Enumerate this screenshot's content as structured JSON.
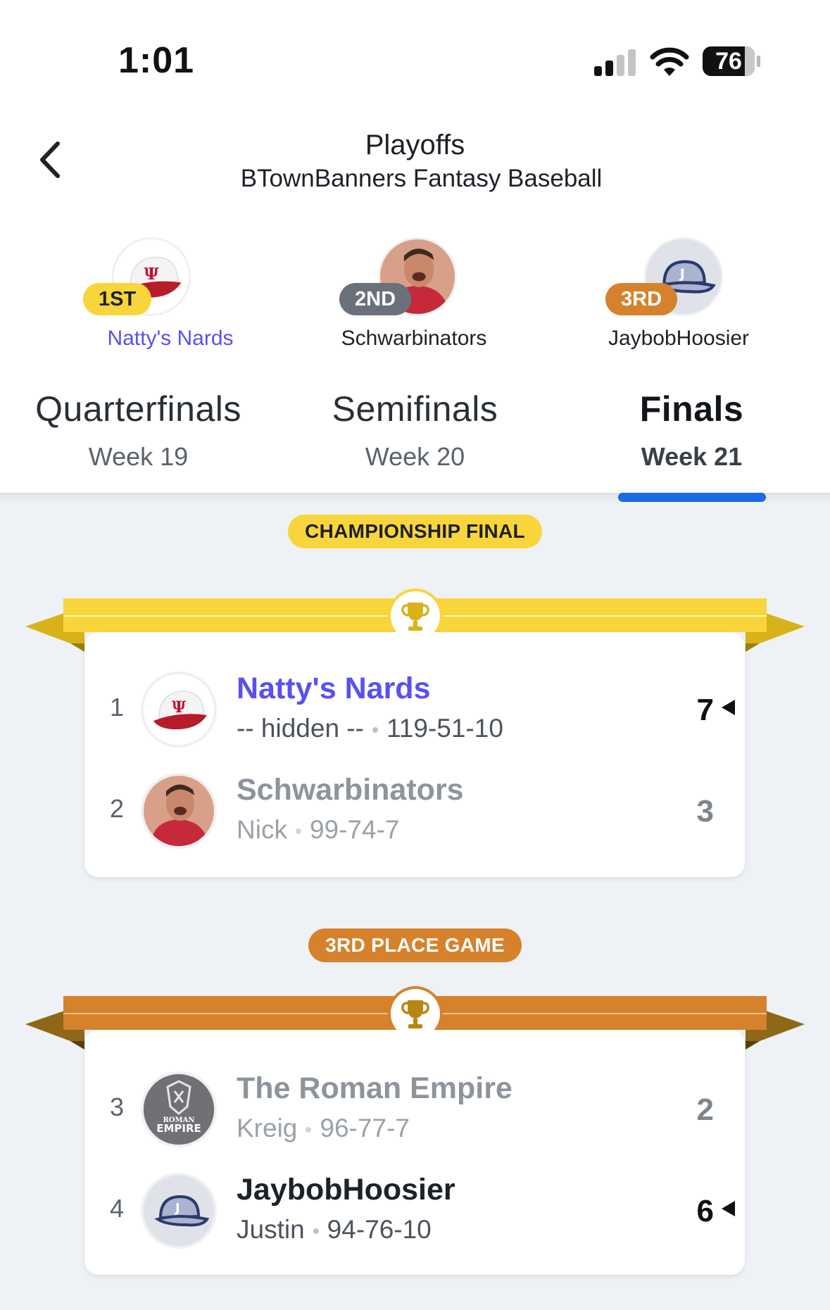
{
  "status_bar": {
    "time": "1:01",
    "battery": "76"
  },
  "header": {
    "title": "Playoffs",
    "subtitle": "BTownBanners Fantasy Baseball"
  },
  "podium": [
    {
      "place": "1ST",
      "name": "Natty's Nards",
      "badge_color": "#f9d53c",
      "badge_text_color": "#1d2128",
      "name_color": "#5a4ff0"
    },
    {
      "place": "2ND",
      "name": "Schwarbinators",
      "badge_color": "#6b717a",
      "badge_text_color": "#ffffff",
      "name_color": "#1d2128"
    },
    {
      "place": "3RD",
      "name": "JaybobHoosier",
      "badge_color": "#d6822c",
      "badge_text_color": "#ffffff",
      "name_color": "#1d2128"
    }
  ],
  "tabs": [
    {
      "label": "Quarterfinals",
      "week": "Week 19",
      "active": false
    },
    {
      "label": "Semifinals",
      "week": "Week 20",
      "active": false
    },
    {
      "label": "Finals",
      "week": "Week 21",
      "active": true
    }
  ],
  "championship": {
    "label": "CHAMPIONSHIP FINAL",
    "color": "#f9d53c",
    "teams": [
      {
        "seed": "1",
        "name": "Natty's Nards",
        "owner": "-- hidden --",
        "record": "119-51-10",
        "score": "7",
        "winner": true
      },
      {
        "seed": "2",
        "name": "Schwarbinators",
        "owner": "Nick",
        "record": "99-74-7",
        "score": "3",
        "winner": false
      }
    ]
  },
  "third_place": {
    "label": "3RD PLACE GAME",
    "color": "#d6822c",
    "teams": [
      {
        "seed": "3",
        "name": "The Roman Empire",
        "owner": "Kreig",
        "record": "96-77-7",
        "score": "2",
        "winner": false
      },
      {
        "seed": "4",
        "name": "JaybobHoosier",
        "owner": "Justin",
        "record": "94-76-10",
        "score": "6",
        "winner": true
      }
    ]
  },
  "avatar_labels": {
    "roman_line1": "ROMAN",
    "roman_line2": "EMPIRE",
    "cap_letter": "J"
  },
  "icons": {
    "back": "chevron-left-icon",
    "trophy": "trophy-icon",
    "win": "triangle-left-icon"
  }
}
